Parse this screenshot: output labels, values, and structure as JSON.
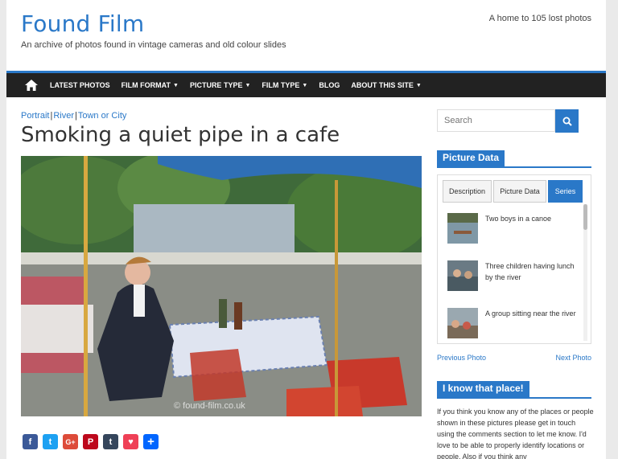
{
  "site": {
    "title": "Found Film",
    "description": "An archive of photos found in vintage cameras and old colour slides",
    "tagline": "A home to 105 lost photos"
  },
  "nav": {
    "items": [
      {
        "label": "LATEST PHOTOS",
        "dropdown": false
      },
      {
        "label": "FILM FORMAT",
        "dropdown": true
      },
      {
        "label": "PICTURE TYPE",
        "dropdown": true
      },
      {
        "label": "FILM TYPE",
        "dropdown": true
      },
      {
        "label": "BLOG",
        "dropdown": false
      },
      {
        "label": "ABOUT THIS SITE",
        "dropdown": true
      }
    ]
  },
  "post": {
    "categories": [
      "Portrait",
      "River",
      "Town or City"
    ],
    "separator": "|",
    "title": "Smoking a quiet pipe in a cafe",
    "watermark": "© found-film.co.uk"
  },
  "share": {
    "buttons": [
      {
        "icon": "facebook-icon",
        "glyph": "f",
        "color": "#3b5998"
      },
      {
        "icon": "twitter-icon",
        "glyph": "t",
        "color": "#1da1f2"
      },
      {
        "icon": "google-plus-icon",
        "glyph": "G+",
        "color": "#dd4b39"
      },
      {
        "icon": "pinterest-icon",
        "glyph": "P",
        "color": "#bd081c"
      },
      {
        "icon": "tumblr-icon",
        "glyph": "t",
        "color": "#35465c"
      },
      {
        "icon": "pocket-icon",
        "glyph": "♥",
        "color": "#ef4056"
      },
      {
        "icon": "share-plus-icon",
        "glyph": "+",
        "color": "#0166ff"
      }
    ]
  },
  "sidebar": {
    "search": {
      "placeholder": "Search"
    },
    "picture_data_heading": "Picture Data",
    "tabs": [
      {
        "label": "Description",
        "active": false
      },
      {
        "label": "Picture Data",
        "active": false
      },
      {
        "label": "Series",
        "active": true
      }
    ],
    "series": [
      {
        "caption": "Two boys in a canoe"
      },
      {
        "caption": "Three children having lunch by the river"
      },
      {
        "caption": "A group sitting near the river"
      }
    ],
    "previous_label": "Previous Photo",
    "next_label": "Next Photo",
    "know_heading": "I know that place!",
    "know_text": "If you think you know any of the places or people shown in these pictures please get in touch using the comments section to let me know. I'd love to be able to properly identify locations or people. Also if you think any"
  },
  "colors": {
    "accent": "#2a78c8",
    "nav_bg": "#222222"
  }
}
